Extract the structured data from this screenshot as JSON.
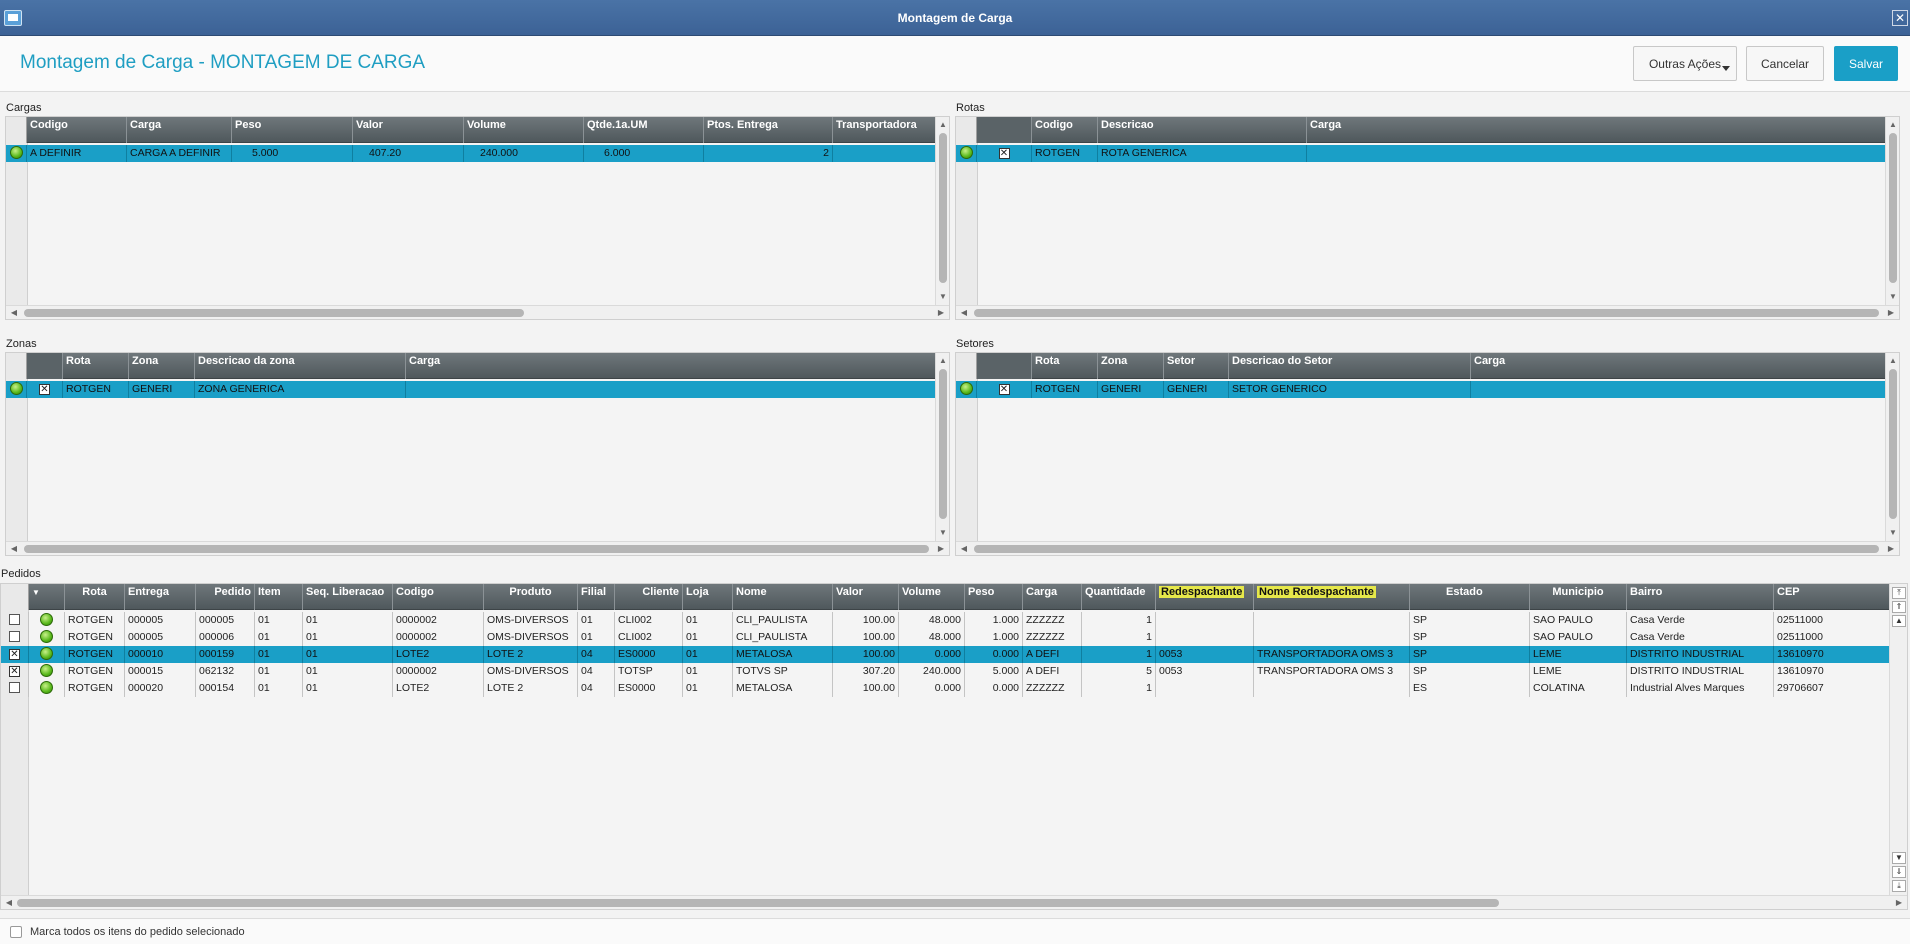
{
  "window": {
    "title": "Montagem de Carga"
  },
  "header": {
    "title": "Montagem de Carga - MONTAGEM DE CARGA",
    "outras_label": "Outras Ações",
    "cancelar_label": "Cancelar",
    "salvar_label": "Salvar"
  },
  "cargas": {
    "label": "Cargas",
    "columns": [
      "Codigo",
      "Carga",
      "Peso",
      "Valor",
      "Volume",
      "Qtde.1a.UM",
      "Ptos. Entrega",
      "Transportadora"
    ],
    "rows": [
      [
        "A DEFINIR",
        "CARGA A DEFINIR",
        "5.000",
        "407.20",
        "240.000",
        "6.000",
        "2",
        ""
      ]
    ]
  },
  "rotas": {
    "label": "Rotas",
    "columns": [
      "Codigo",
      "Descricao",
      "Carga"
    ],
    "rows": [
      [
        "ROTGEN",
        "ROTA GENERICA",
        ""
      ]
    ]
  },
  "zonas": {
    "label": "Zonas",
    "columns": [
      "Rota",
      "Zona",
      "Descricao da zona",
      "Carga"
    ],
    "rows": [
      [
        "ROTGEN",
        "GENERI",
        "ZONA GENERICA",
        ""
      ]
    ]
  },
  "setores": {
    "label": "Setores",
    "columns": [
      "Rota",
      "Zona",
      "Setor",
      "Descricao do Setor",
      "Carga"
    ],
    "rows": [
      [
        "ROTGEN",
        "GENERI",
        "GENERI",
        "SETOR GENERICO",
        ""
      ]
    ]
  },
  "pedidos": {
    "label": "Pedidos",
    "columns": [
      "Rota",
      "Entrega",
      "Pedido",
      "Item",
      "Seq. Liberacao",
      "Codigo",
      "Produto",
      "Filial",
      "Cliente",
      "Loja",
      "Nome",
      "Valor",
      "Volume",
      "Peso",
      "Carga",
      "Quantidade",
      "Redespachante",
      "Nome Redespachante",
      "Estado",
      "Municipio",
      "Bairro",
      "CEP"
    ],
    "rows": [
      [
        "ROTGEN",
        "000005",
        "000005",
        "01",
        "01",
        "0000002",
        "OMS-DIVERSOS",
        "01",
        "CLI002",
        "01",
        "CLI_PAULISTA",
        "100.00",
        "48.000",
        "1.000",
        "ZZZZZZ",
        "1",
        "",
        "",
        "SP",
        "SAO PAULO",
        "Casa Verde",
        "02511000"
      ],
      [
        "ROTGEN",
        "000005",
        "000006",
        "01",
        "01",
        "0000002",
        "OMS-DIVERSOS",
        "01",
        "CLI002",
        "01",
        "CLI_PAULISTA",
        "100.00",
        "48.000",
        "1.000",
        "ZZZZZZ",
        "1",
        "",
        "",
        "SP",
        "SAO PAULO",
        "Casa Verde",
        "02511000"
      ],
      [
        "ROTGEN",
        "000010",
        "000159",
        "01",
        "01",
        "LOTE2",
        "LOTE 2",
        "04",
        "ES0000",
        "01",
        "METALOSA",
        "100.00",
        "0.000",
        "0.000",
        "A DEFI",
        "1",
        "0053",
        "TRANSPORTADORA OMS 3",
        "SP",
        "LEME",
        "DISTRITO INDUSTRIAL",
        "13610970"
      ],
      [
        "ROTGEN",
        "000015",
        "062132",
        "01",
        "01",
        "0000002",
        "OMS-DIVERSOS",
        "04",
        "TOTSP",
        "01",
        "TOTVS SP",
        "307.20",
        "240.000",
        "5.000",
        "A DEFI",
        "5",
        "0053",
        "TRANSPORTADORA OMS 3",
        "SP",
        "LEME",
        "DISTRITO INDUSTRIAL",
        "13610970"
      ],
      [
        "ROTGEN",
        "000020",
        "000154",
        "01",
        "01",
        "LOTE2",
        "LOTE 2",
        "04",
        "ES0000",
        "01",
        "METALOSA",
        "100.00",
        "0.000",
        "0.000",
        "ZZZZZZ",
        "1",
        "",
        "",
        "ES",
        "COLATINA",
        "Industrial Alves Marques",
        "29706607"
      ]
    ]
  },
  "footer": {
    "label": "Marca todos os itens do pedido selecionado"
  }
}
